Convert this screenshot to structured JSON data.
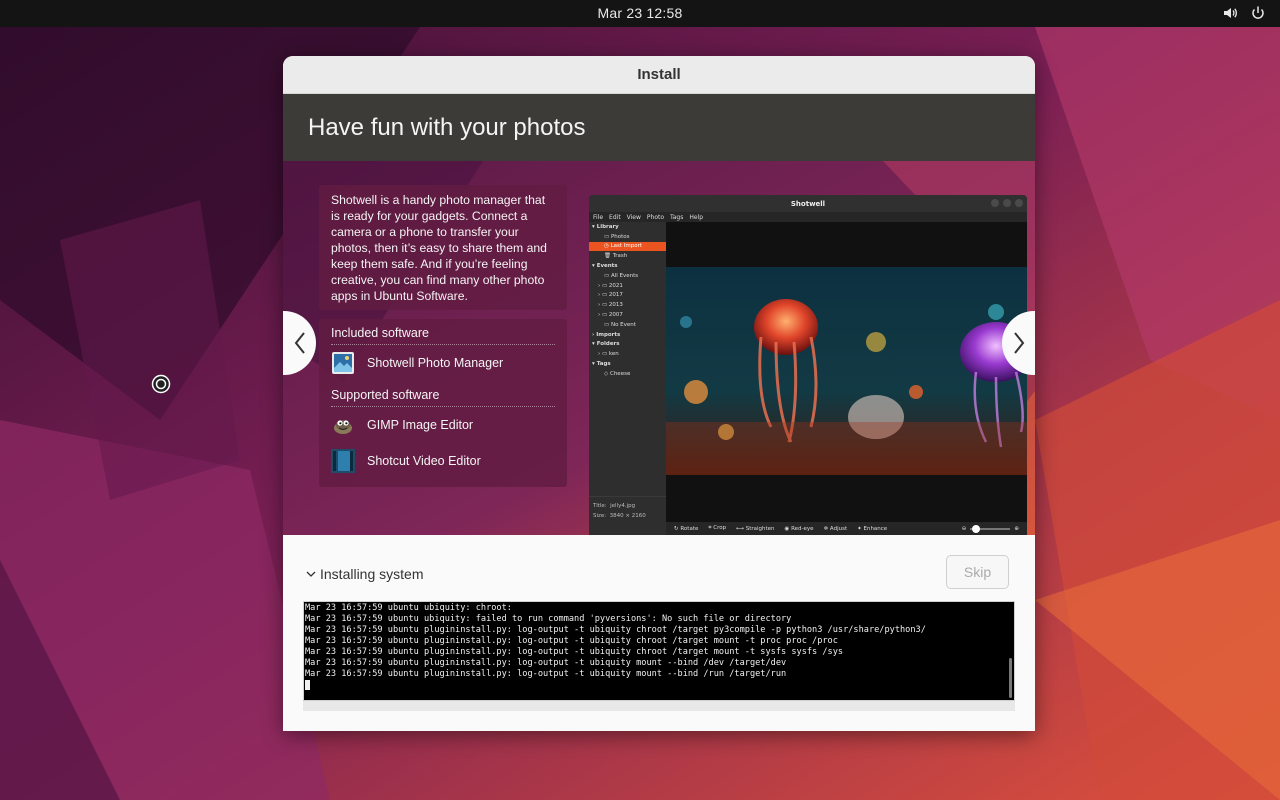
{
  "topbar": {
    "clock": "Mar 23  12:58",
    "tray_icons": [
      "volume-icon",
      "power-icon"
    ]
  },
  "window": {
    "title": "Install",
    "slide": {
      "heading": "Have fun with your photos",
      "description": "Shotwell is a handy photo manager that is ready for your gadgets. Connect a camera or a phone to transfer your photos, then it’s easy to share them and keep them safe. And if you’re feeling creative, you can find many other photo apps in Ubuntu Software.",
      "included_heading": "Included software",
      "included": [
        {
          "name": "Shotwell Photo Manager",
          "icon": "shotwell-icon"
        }
      ],
      "supported_heading": "Supported software",
      "supported": [
        {
          "name": "GIMP Image Editor",
          "icon": "gimp-icon"
        },
        {
          "name": "Shotcut Video Editor",
          "icon": "shotcut-icon"
        }
      ],
      "prev_glyph": "❬",
      "next_glyph": "❭",
      "screenshot": {
        "title": "Shotwell",
        "menu": [
          "File",
          "Edit",
          "View",
          "Photo",
          "Tags",
          "Help"
        ],
        "sidebar": [
          "Library",
          "Photos",
          "Last Import",
          "Trash",
          "Events",
          "All Events",
          "2021",
          "2017",
          "2013",
          "2007",
          "No Event",
          "Imports",
          "Folders",
          "ken",
          "Tags",
          "Cheese"
        ],
        "info_title_label": "Title:",
        "info_title": "jelly4.jpg",
        "info_size_label": "Size:",
        "info_size": "3840 × 2160",
        "toolbar": [
          "Rotate",
          "Crop",
          "Straighten",
          "Red-eye",
          "Adjust",
          "Enhance"
        ]
      }
    },
    "status": {
      "label": "Installing system",
      "skip_label": "Skip"
    },
    "log": [
      "Mar 23 16:57:59 ubuntu ubiquity: chroot:",
      "Mar 23 16:57:59 ubuntu ubiquity: failed to run command 'pyversions': No such file or directory",
      "Mar 23 16:57:59 ubuntu plugininstall.py: log-output -t ubiquity chroot /target py3compile -p python3 /usr/share/python3/",
      "Mar 23 16:57:59 ubuntu plugininstall.py: log-output -t ubiquity chroot /target mount -t proc proc /proc",
      "Mar 23 16:57:59 ubuntu plugininstall.py: log-output -t ubiquity chroot /target mount -t sysfs sysfs /sys",
      "Mar 23 16:57:59 ubuntu plugininstall.py: log-output -t ubiquity mount --bind /dev /target/dev",
      "Mar 23 16:57:59 ubuntu plugininstall.py: log-output -t ubiquity mount --bind /run /target/run"
    ]
  },
  "colors": {
    "accent": "#e95420",
    "header_bg": "#3c3b37",
    "slide_bg": "#6a2450"
  }
}
